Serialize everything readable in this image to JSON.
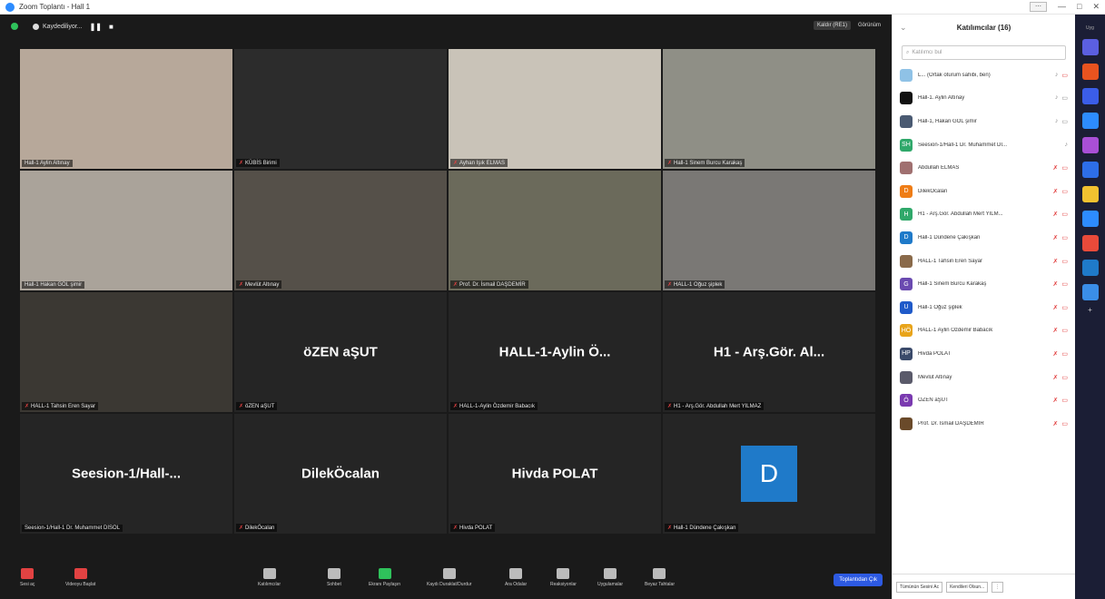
{
  "window": {
    "title": "Zoom Toplantı - Hall 1",
    "minimize": "—",
    "restore": "□",
    "close": "✕",
    "mini_box": "⋯"
  },
  "meeting_top": {
    "recording_label": "Kaydediliyor...",
    "pause": "❚❚",
    "stop": "■",
    "exit_fullscreen": "Kaldır (RE1)",
    "view_label": "Görünüm"
  },
  "tiles": [
    {
      "name": "Hall-1 Aylin Altınay",
      "type": "video",
      "bg": "#b7a89a",
      "muted": false
    },
    {
      "name": "KÜBİS Birimi",
      "type": "video",
      "bg": "#2c2c2c",
      "muted": true
    },
    {
      "name": "Ayhan Işık ELMAS",
      "type": "video",
      "bg": "#c9c3b8",
      "muted": true
    },
    {
      "name": "Hall-1 Sinem Burcu Karakaş",
      "type": "video",
      "bg": "#8f8f86",
      "muted": true
    },
    {
      "name": "Hall-1 Hakan GÖL şimir",
      "type": "video",
      "bg": "#aaa39a",
      "muted": false,
      "active": true
    },
    {
      "name": "Mevlüt Altınay",
      "type": "video",
      "bg": "#555049",
      "muted": true
    },
    {
      "name": "Prof. Dr. İsmail DAŞDEMİR",
      "type": "video",
      "bg": "#6b6a5b",
      "muted": true
    },
    {
      "name": "HALL-1 Oğuz şiplek",
      "type": "video",
      "bg": "#7a7875",
      "muted": true
    },
    {
      "name": "HALL-1 Tahsin Eren Sayar",
      "type": "video",
      "bg": "#3b3833",
      "muted": true
    },
    {
      "name": "öZEN aŞUT",
      "type": "name",
      "big": "öZEN aŞUT",
      "muted": true
    },
    {
      "name": "HALL-1-Aylin Özdemir Babacık",
      "type": "name",
      "big": "HALL-1-Aylin Ö...",
      "muted": true
    },
    {
      "name": "H1 - Arş.Gör. Abdullah Mert YILMAZ",
      "type": "name",
      "big": "H1 - Arş.Gör. Al...",
      "muted": true
    },
    {
      "name": "Seesion-1/Hall-1 Dr. Muhammet DİSÖL",
      "type": "name",
      "big": "Seesion-1/Hall-...",
      "muted": false
    },
    {
      "name": "DilekÖcalan",
      "type": "name",
      "big": "DilekÖcalan",
      "muted": true
    },
    {
      "name": "Hivda POLAT",
      "type": "name",
      "big": "Hivda POLAT",
      "muted": true
    },
    {
      "name": "Hall-1 Dündene Çakışkan",
      "type": "avatar",
      "big": "D",
      "muted": true
    }
  ],
  "toolbar": {
    "mute": "Sesi aç",
    "video": "Videoyu Başlat",
    "participants": "Katılımcılar",
    "participants_count": "16",
    "chat": "Sohbet",
    "share": "Ekranı Paylaşın",
    "record": "Kaydı Duraklat/Durdur",
    "breakout": "Ara Odalar",
    "reactions": "Reaksiyonlar",
    "apps": "Uygulamalar",
    "whiteboard": "Beyaz Tahtalar",
    "end": "Toplantıdan Çık"
  },
  "panel": {
    "title": "Katılımcılar (16)",
    "collapse": "⌄",
    "search_placeholder": "Katılımcı bul",
    "participants": [
      {
        "name": "L... (Ortak oturum sahibi, ben)",
        "color": "#8fc2e6",
        "initial": "",
        "mic": "on",
        "cam": "off"
      },
      {
        "name": "Hall-1. Aylin Altınay",
        "color": "#111111",
        "initial": "",
        "mic": "on",
        "cam": "on"
      },
      {
        "name": "Hall-1, Hakan GÖL şimir",
        "color": "#4a5a72",
        "initial": "",
        "mic": "on",
        "cam": "on"
      },
      {
        "name": "Seesion-1/Hall-1 Dr. Muhammet Dİ...",
        "color": "#2fa86a",
        "initial": "SH",
        "mic": "on",
        "cam": ""
      },
      {
        "name": "Abdullah ELMAS",
        "color": "#a07070",
        "initial": "",
        "mic": "off",
        "cam": "off"
      },
      {
        "name": "DilekÖcalan",
        "color": "#ef7d16",
        "initial": "D",
        "mic": "off",
        "cam": "off"
      },
      {
        "name": "H1 - Arş.Gör. Abdullah Mert YILM...",
        "color": "#2fa86a",
        "initial": "H",
        "mic": "off",
        "cam": "off"
      },
      {
        "name": "Hall-1 Dündene Çakışkan",
        "color": "#1f7ac9",
        "initial": "D",
        "mic": "off",
        "cam": "off"
      },
      {
        "name": "HALL-1 Tahsin Eren Sayar",
        "color": "#8a6a4a",
        "initial": "",
        "mic": "off",
        "cam": "off"
      },
      {
        "name": "Hall-1 Sinem Burcu Karakaş",
        "color": "#6a4ab0",
        "initial": "G",
        "mic": "off",
        "cam": "off"
      },
      {
        "name": "Hall-1 Oğuz şiplek",
        "color": "#1f5ac9",
        "initial": "U",
        "mic": "off",
        "cam": "off"
      },
      {
        "name": "HALL-1 Aylin Özdemir Babacık",
        "color": "#e8a41a",
        "initial": "HÖ",
        "mic": "off",
        "cam": "off"
      },
      {
        "name": "Hivda POLAT",
        "color": "#3a4a6a",
        "initial": "HP",
        "mic": "off",
        "cam": "off"
      },
      {
        "name": "Mevlüt Altınay",
        "color": "#5a5a6a",
        "initial": "",
        "mic": "off",
        "cam": "off"
      },
      {
        "name": "ÖZEN aŞUT",
        "color": "#7a3ab0",
        "initial": "Ö",
        "mic": "off",
        "cam": "off"
      },
      {
        "name": "Prof. Dr. İsmail DAŞDEMİR",
        "color": "#6a4a2a",
        "initial": "",
        "mic": "off",
        "cam": "off"
      }
    ],
    "footer_mute_all": "Tümünün Sesini Ac",
    "footer_ask_unmute": "Kendileri Olsun...",
    "footer_more": "⋮"
  },
  "appbar": {
    "label": "Uyg",
    "apps": [
      "#5b5fe0",
      "#e8531f",
      "#3b5de8",
      "#2d8cff",
      "#a94fd6",
      "#2d6ee8",
      "#f2c230",
      "#2d8cff",
      "#e84a3a",
      "#1f7ac9",
      "#3a8ee8"
    ],
    "more": "+"
  },
  "colors": {
    "meeting_bg": "#1a1a1a",
    "active_outline": "#c7e05a",
    "end_button": "#2d5ae2"
  }
}
